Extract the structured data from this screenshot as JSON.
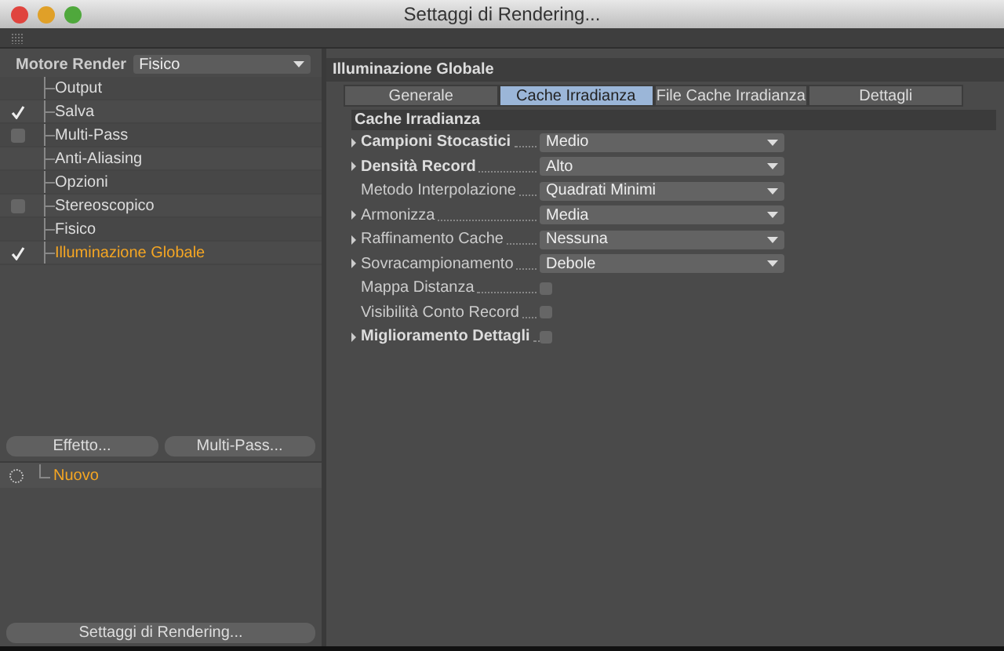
{
  "window": {
    "title": "Settaggi di Rendering..."
  },
  "renderer": {
    "label": "Motore Render",
    "value": "Fisico"
  },
  "settings": [
    {
      "label": "Output",
      "kind": "plain",
      "selected": false
    },
    {
      "label": "Salva",
      "kind": "check",
      "checked": true,
      "selected": false
    },
    {
      "label": "Multi-Pass",
      "kind": "check",
      "checked": false,
      "selected": false
    },
    {
      "label": "Anti-Aliasing",
      "kind": "plain",
      "selected": false
    },
    {
      "label": "Opzioni",
      "kind": "plain",
      "selected": false
    },
    {
      "label": "Stereoscopico",
      "kind": "check",
      "checked": false,
      "selected": false
    },
    {
      "label": "Fisico",
      "kind": "plain",
      "selected": false
    },
    {
      "label": "Illuminazione Globale",
      "kind": "check",
      "checked": true,
      "selected": true
    }
  ],
  "left_buttons": [
    "Effetto...",
    "Multi-Pass..."
  ],
  "effects": [
    {
      "label": "Nuovo",
      "selected": true
    }
  ],
  "bottom_button": "Settaggi di Rendering...",
  "panel": {
    "title": "Illuminazione Globale",
    "tabs": [
      {
        "label": "Generale",
        "selected": false
      },
      {
        "label": "Cache Irradianza",
        "selected": true
      },
      {
        "label": "File Cache Irradianza",
        "selected": false
      },
      {
        "label": "Dettagli",
        "selected": false
      }
    ],
    "section": "Cache Irradianza",
    "properties": [
      {
        "label": "Campioni Stocastici",
        "kind": "dropdown",
        "value": "Medio",
        "bold": true,
        "expandable": true
      },
      {
        "label": "Densità Record",
        "kind": "dropdown",
        "value": "Alto",
        "bold": true,
        "expandable": true
      },
      {
        "label": "Metodo Interpolazione",
        "kind": "dropdown",
        "value": "Quadrati Minimi",
        "bold": false,
        "expandable": false
      },
      {
        "label": "Armonizza",
        "kind": "dropdown",
        "value": "Media",
        "bold": false,
        "expandable": true
      },
      {
        "label": "Raffinamento Cache",
        "kind": "dropdown",
        "value": "Nessuna",
        "bold": false,
        "expandable": true
      },
      {
        "label": "Sovracampionamento",
        "kind": "dropdown",
        "value": "Debole",
        "bold": false,
        "expandable": true
      },
      {
        "label": "Mappa Distanza",
        "kind": "checkbox",
        "checked": false,
        "bold": false,
        "expandable": false
      },
      {
        "label": "Visibilità Conto Record",
        "kind": "checkbox",
        "checked": false,
        "bold": false,
        "expandable": false
      },
      {
        "label": "Miglioramento Dettagli",
        "kind": "checkbox",
        "checked": false,
        "bold": true,
        "expandable": true
      }
    ]
  }
}
